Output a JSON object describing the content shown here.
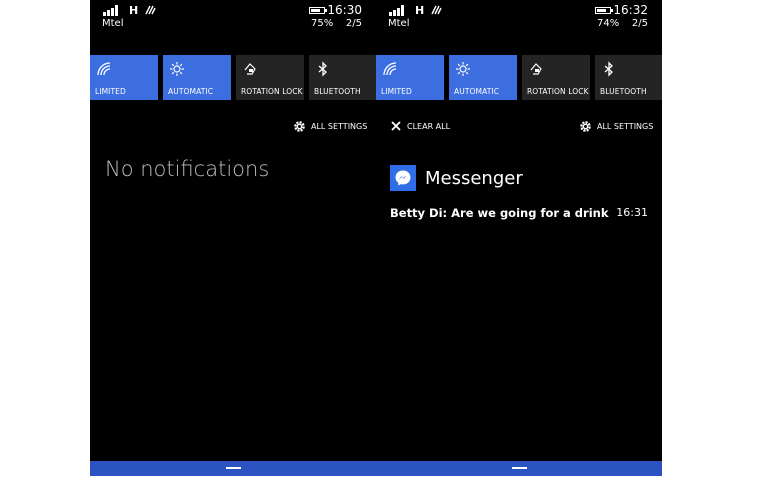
{
  "left": {
    "status": {
      "network": "H",
      "carrier": "Mtel",
      "battery_percent": "75%",
      "battery_level": 0.75,
      "time": "16:30",
      "page": "2/5"
    },
    "quick_actions": [
      {
        "label": "LIMITED",
        "icon": "wifi-icon",
        "active": true
      },
      {
        "label": "AUTOMATIC",
        "icon": "brightness-icon",
        "active": true
      },
      {
        "label": "ROTATION LOCK",
        "icon": "rotation-lock-icon",
        "active": false
      },
      {
        "label": "BLUETOOTH",
        "icon": "bluetooth-icon",
        "active": false
      }
    ],
    "all_settings": "ALL SETTINGS",
    "empty_message": "No notifications"
  },
  "right": {
    "status": {
      "network": "H",
      "carrier": "Mtel",
      "battery_percent": "74%",
      "battery_level": 0.74,
      "time": "16:32",
      "page": "2/5"
    },
    "quick_actions": [
      {
        "label": "LIMITED",
        "icon": "wifi-icon",
        "active": true
      },
      {
        "label": "AUTOMATIC",
        "icon": "brightness-icon",
        "active": true
      },
      {
        "label": "ROTATION LOCK",
        "icon": "rotation-lock-icon",
        "active": false
      },
      {
        "label": "BLUETOOTH",
        "icon": "bluetooth-icon",
        "active": false
      }
    ],
    "clear_all": "CLEAR ALL",
    "all_settings": "ALL SETTINGS",
    "notification": {
      "app": "Messenger",
      "app_icon": "messenger-icon",
      "text": "Betty Di: Are we going for a drink",
      "time": "16:31"
    }
  },
  "colors": {
    "accent": "#3d6ee0",
    "nav_bar": "#2b53c2",
    "background": "#000000",
    "tile_off": "#242424"
  }
}
